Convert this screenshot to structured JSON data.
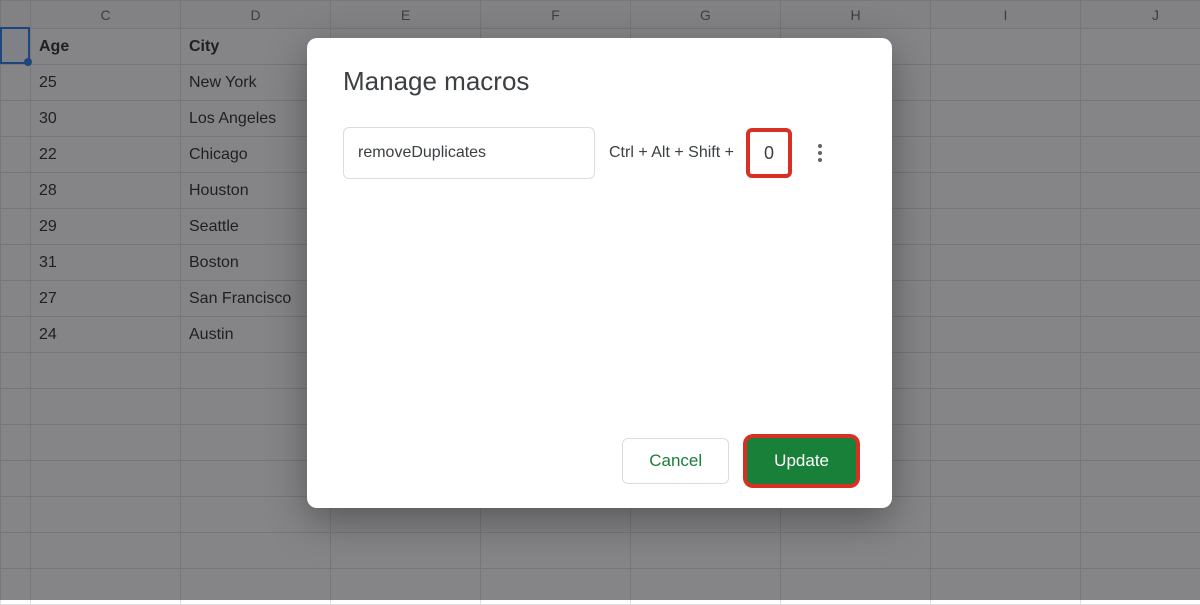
{
  "columns": [
    "C",
    "D",
    "E",
    "F",
    "G",
    "H",
    "I",
    "J"
  ],
  "spreadsheet": {
    "headers": {
      "age": "Age",
      "city": "City"
    },
    "rows": [
      {
        "age": "25",
        "city": "New York"
      },
      {
        "age": "30",
        "city": "Los Angeles"
      },
      {
        "age": "22",
        "city": "Chicago"
      },
      {
        "age": "28",
        "city": "Houston"
      },
      {
        "age": "29",
        "city": "Seattle"
      },
      {
        "age": "31",
        "city": "Boston"
      },
      {
        "age": "27",
        "city": "San Francisco"
      },
      {
        "age": "24",
        "city": "Austin"
      }
    ]
  },
  "dialog": {
    "title": "Manage macros",
    "macro_name": "removeDuplicates",
    "shortcut_prefix": "Ctrl + Alt + Shift +",
    "shortcut_key": "0",
    "cancel_label": "Cancel",
    "update_label": "Update"
  }
}
